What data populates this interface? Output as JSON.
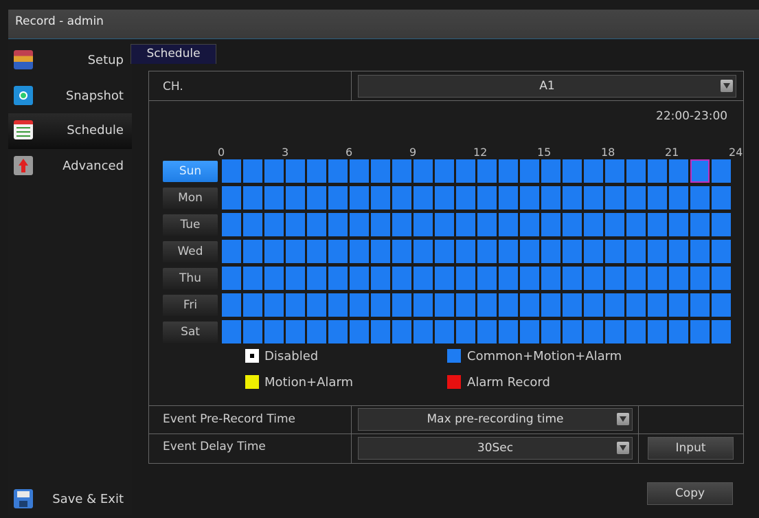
{
  "window": {
    "title": "Record - admin"
  },
  "sidebar": {
    "items": [
      {
        "label": "Setup",
        "icon": "setup-icon"
      },
      {
        "label": "Snapshot",
        "icon": "camera-icon"
      },
      {
        "label": "Schedule",
        "icon": "calendar-icon",
        "active": true
      },
      {
        "label": "Advanced",
        "icon": "advanced-icon"
      }
    ],
    "save_exit": {
      "label": "Save & Exit",
      "icon": "floppy-disk-icon"
    }
  },
  "tabs": [
    {
      "label": "Schedule",
      "active": true
    }
  ],
  "channel": {
    "label": "CH.",
    "value": "A1"
  },
  "schedule": {
    "time_range": "22:00-23:00",
    "hour_labels": [
      "0",
      "3",
      "6",
      "9",
      "12",
      "15",
      "18",
      "21",
      "24"
    ],
    "days": [
      "Sun",
      "Mon",
      "Tue",
      "Wed",
      "Thu",
      "Fri",
      "Sat"
    ],
    "selected_day": "Sun",
    "cell_color": "#1e7cf2",
    "highlight_cell": {
      "day": "Sun",
      "hour": 22,
      "color": "#c030c0"
    }
  },
  "legend": [
    {
      "label": "Disabled",
      "color": "#ffffff"
    },
    {
      "label": "Common+Motion+Alarm",
      "color": "#1e7cf2"
    },
    {
      "label": "Motion+Alarm",
      "color": "#f0f000"
    },
    {
      "label": "Alarm Record",
      "color": "#e81010"
    }
  ],
  "pre_record": {
    "label": "Event Pre-Record Time",
    "value": "Max pre-recording time"
  },
  "delay": {
    "label": "Event Delay Time",
    "value": "30Sec",
    "input_button": "Input"
  },
  "copy_button": "Copy"
}
